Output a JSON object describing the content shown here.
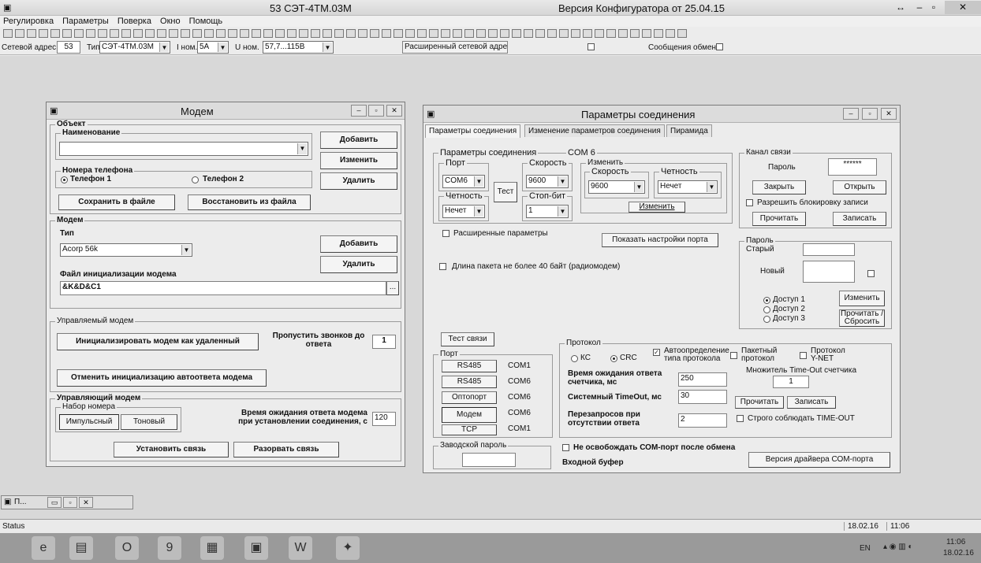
{
  "window": {
    "title": "53  СЭТ-4ТМ.03М",
    "subtitle": "Версия Конфигуратора  от 25.04.15",
    "minimize": "–",
    "maximize": "▫",
    "close": "✕"
  },
  "menu": [
    "Регулировка",
    "Параметры",
    "Поверка",
    "Окно",
    "Помощь"
  ],
  "addressbar": {
    "net_address_label": "Сетевой адрес",
    "net_address_value": "53",
    "type_label": "Тип",
    "type_value": "СЭТ-4ТМ.03М",
    "inom_label": "I ном.",
    "inom_value": "5А",
    "unom_label": "U ном.",
    "unom_value": "57,7...115В",
    "ext_address_button": "Расширенный сетевой адрес",
    "exchange_messages_label": "Сообщения обмена"
  },
  "modem_window": {
    "title": "Модем",
    "object_group": "Объект",
    "name_group": "Наименование",
    "add_button": "Добавить",
    "change_button": "Изменить",
    "delete_button": "Удалить",
    "phones_group": "Номера телефона",
    "phone1": "Телефон 1",
    "phone2": "Телефон 2",
    "save_button": "Сохранить в файле",
    "restore_button": "Восстановить из файла",
    "modem_group": "Модем",
    "type_label": "Тип",
    "type_value": "Acorp 56k",
    "modem_add": "Добавить",
    "modem_delete": "Удалить",
    "init_file_label": "Файл инициализации модема",
    "init_file_value": "&K&D&C1",
    "browse": "...",
    "managed_group": "Управляемый модем",
    "init_remote_button": "Инициализировать модем как удаленный",
    "skip_rings_label": "Пропустить звонков до ответа",
    "skip_rings_value": "1",
    "cancel_autoanswer_button": "Отменить инициализацию автоответа модема",
    "control_group": "Управляющий модем",
    "dial_group": "Набор номера",
    "pulse": "Импульсный",
    "tone": "Тоновый",
    "wait_label": "Время ожидания ответа модема при установлении соединения, с",
    "wait_value": "120",
    "connect_button": "Установить связь",
    "disconnect_button": "Разорвать связь"
  },
  "conn_window": {
    "title": "Параметры соединения",
    "tabs": [
      "Параметры соединения",
      "Изменение параметров соединения",
      "Пирамида"
    ],
    "params_group": "Параметры соединения",
    "com_label": "COM 6",
    "port_group": "Порт",
    "port_value": "COM6",
    "speed_group": "Скорость",
    "speed_value": "9600",
    "test_button": "Тест",
    "parity_group": "Четность",
    "parity_value": "Нечет",
    "stopbits_group": "Стоп-бит",
    "stopbits_value": "1",
    "change_group": "Изменить",
    "ch_speed_group": "Скорость",
    "ch_speed_value": "9600",
    "ch_parity_group": "Четность",
    "ch_parity_value": "Нечет",
    "ch_change_button": "Изменить",
    "extended_params": "Расширенные параметры",
    "show_port_settings": "Показать настройки порта",
    "packet_len_label": "Длина пакета не более 40 байт (радиомодем)",
    "channel_group": "Канал связи",
    "password_label": "Пароль",
    "password_value": "******",
    "close_button": "Закрыть",
    "open_button": "Открыть",
    "allow_lock_label": "Разрешить блокировку записи",
    "read_button": "Прочитать",
    "write_button": "Записать",
    "password_group": "Пароль",
    "old_label": "Старый",
    "new_label": "Новый",
    "access1": "Доступ 1",
    "access2": "Доступ 2",
    "access3": "Доступ 3",
    "change_pw_button": "Изменить",
    "read_reset_button": "Прочитать / Сбросить",
    "test_link_button": "Тест связи",
    "ports_group": "Порт",
    "ports": [
      {
        "button": "RS485",
        "com": "COM1"
      },
      {
        "button": "RS485",
        "com": "COM6"
      },
      {
        "button": "Оптопорт",
        "com": "COM6"
      },
      {
        "button": "Модем",
        "com": "COM6"
      },
      {
        "button": "TCP",
        "com": "COM1"
      }
    ],
    "protocol_group": "Протокол",
    "ks_label": "КС",
    "crc_label": "CRC",
    "autodetect_label": "Автоопределение типа протокола",
    "packet_protocol": "Пакетный протокол",
    "ynet_protocol": "Протокол Y-NET",
    "timeout_mult_label": "Множитель Time-Out счетчика",
    "timeout_mult_value": "1",
    "wait_meter_label": "Время ожидания ответа счетчика, мс",
    "wait_meter_value": "250",
    "system_timeout_label": "Системный TimeOut, мс",
    "system_timeout_value": "30",
    "retries_label": "Перезапросов при отсутствии ответа",
    "retries_value": "2",
    "read_button2": "Прочитать",
    "write_button2": "Записать",
    "strict_timeout": "Строго соблюдать TIME-OUT",
    "factory_pw_group": "Заводской пароль",
    "no_release_label": "Не освобождать СОМ-порт после обмена",
    "input_buffer_label": "Входной буфер",
    "driver_version_button": "Версия драйвера СОМ-порта"
  },
  "minimized_window": "П...",
  "statusbar": {
    "status": "Status",
    "date": "18.02.16",
    "time": "11:06"
  },
  "tray": {
    "lang": "EN",
    "time": "11:06",
    "date": "18.02.16"
  }
}
